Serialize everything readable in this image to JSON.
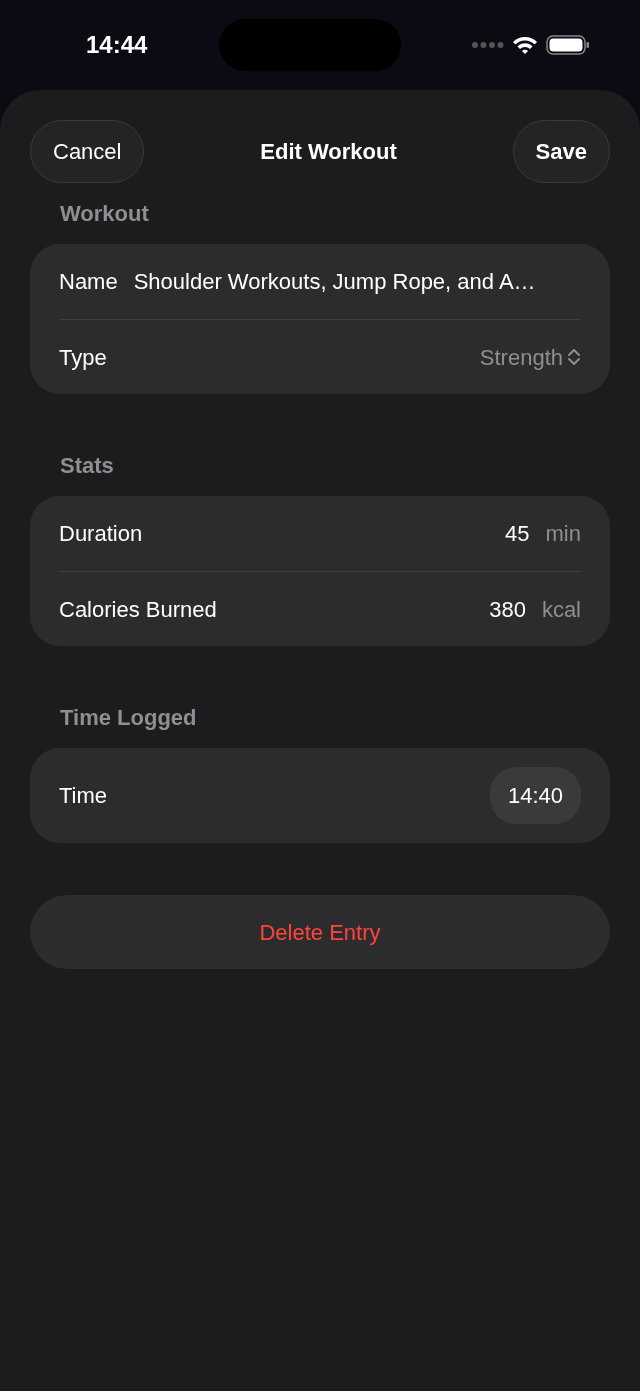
{
  "status_bar": {
    "time": "14:44"
  },
  "nav": {
    "cancel": "Cancel",
    "title": "Edit Workout",
    "save": "Save"
  },
  "sections": [
    {
      "header": "Workout",
      "rows": [
        {
          "kind": "text",
          "label": "Name",
          "value": "Shoulder Workouts, Jump Rope, and A…"
        },
        {
          "kind": "picker",
          "label": "Type",
          "value": "Strength"
        }
      ]
    },
    {
      "header": "Stats",
      "rows": [
        {
          "kind": "number",
          "label": "Duration",
          "value": "45",
          "unit": "min"
        },
        {
          "kind": "number",
          "label": "Calories Burned",
          "value": "380",
          "unit": "kcal"
        }
      ]
    },
    {
      "header": "Time Logged",
      "rows": [
        {
          "kind": "time",
          "label": "Time",
          "value": "14:40"
        }
      ]
    }
  ],
  "delete_button": "Delete Entry"
}
